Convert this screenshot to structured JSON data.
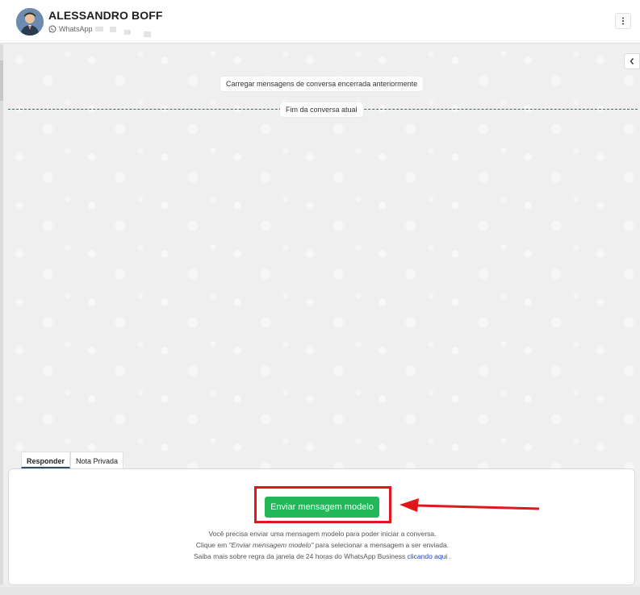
{
  "contact": {
    "name": "ALESSANDRO BOFF",
    "channel": "WhatsApp"
  },
  "chat": {
    "load_previous": "Carregar mensagens de conversa encerrada anteriormente",
    "end_of_conversation": "Fim da conversa atual"
  },
  "composer": {
    "tabs": [
      {
        "label": "Responder",
        "active": true
      },
      {
        "label": "Nota Privada",
        "active": false
      }
    ],
    "template_button": "Enviar mensagem modelo",
    "info_line1": "Você precisa enviar uma mensagem modelo para poder iniciar a conversa.",
    "info_line2_before": "Clique em ",
    "info_line2_em": "\"Enviar mensagem modelo\"",
    "info_line2_after": " para selecionar a mensagem a ser enviada.",
    "info_line3_before": "Saiba mais sobre regra da janela de 24 horas do WhatsApp Business ",
    "info_link": "clicando aqui",
    "info_line3_after": " ."
  },
  "colors": {
    "accent_green": "#22b85a",
    "highlight_red": "#e0161b",
    "link_blue": "#1a3fd0"
  },
  "icons": {
    "channel": "whatsapp-icon",
    "menu": "vertical-dots-icon",
    "collapse": "chevron-left-icon",
    "annotation": "red-arrow-icon"
  }
}
